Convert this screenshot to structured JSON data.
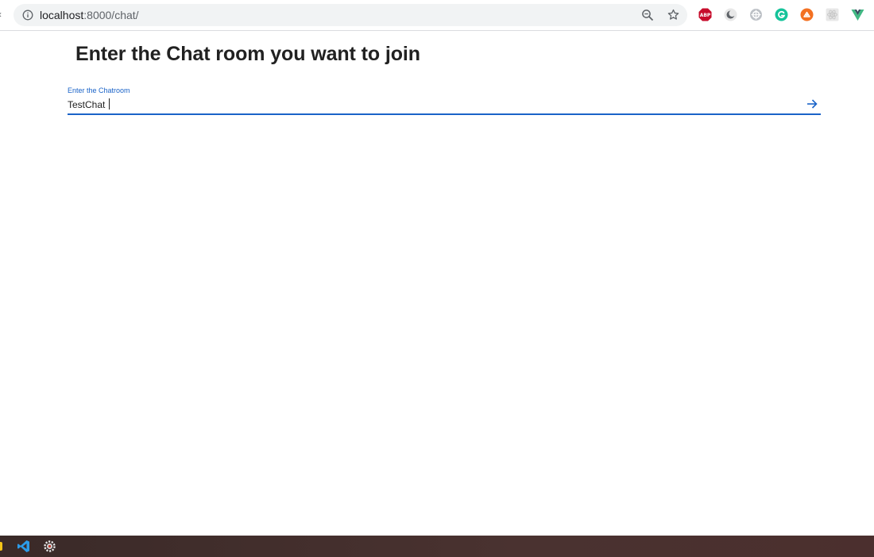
{
  "browser": {
    "url_host": "localhost",
    "url_rest": ":8000/chat/",
    "icons": {
      "info": "info-icon",
      "zoom": "zoom-icon",
      "bookmark": "star-icon"
    },
    "extensions": [
      {
        "name": "adblock-plus-icon",
        "label": "ABP",
        "color": "#c70d2c"
      },
      {
        "name": "dark-mode-icon",
        "color": "#5f6368"
      },
      {
        "name": "extension-gear-icon",
        "color": "#9aa0a6"
      },
      {
        "name": "grammarly-icon",
        "color": "#15c39a"
      },
      {
        "name": "orange-extension-icon",
        "color": "#f37021"
      },
      {
        "name": "react-devtools-icon",
        "color": "#c8c8c8"
      },
      {
        "name": "vue-devtools-icon",
        "color": "#41b883"
      }
    ]
  },
  "page": {
    "title": "Enter the Chat room you want to join",
    "field": {
      "label": "Enter the Chatroom",
      "value": "TestChat",
      "submit_icon": "arrow-right-icon"
    },
    "accent_color": "#1a63c8"
  },
  "taskbar": {
    "items": [
      "sticky-notes-icon",
      "vscode-icon",
      "settings-icon"
    ]
  }
}
